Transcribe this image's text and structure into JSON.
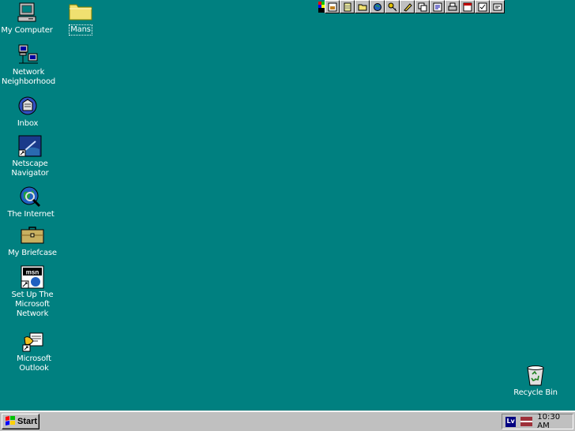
{
  "desktop": {
    "icons": [
      {
        "label": "My Computer",
        "icon": "my-computer-icon"
      },
      {
        "label": "Network\nNeighborhood",
        "icon": "network-icon"
      },
      {
        "label": "Inbox",
        "icon": "inbox-icon"
      },
      {
        "label": "Netscape\nNavigator",
        "icon": "netscape-icon"
      },
      {
        "label": "The Internet",
        "icon": "internet-icon"
      },
      {
        "label": "My Briefcase",
        "icon": "briefcase-icon"
      },
      {
        "label": "Set Up The\nMicrosoft\nNetwork",
        "icon": "msn-icon"
      },
      {
        "label": "Microsoft\nOutlook",
        "icon": "outlook-icon"
      },
      {
        "label": "Mans",
        "icon": "folder-icon"
      },
      {
        "label": "Recycle Bin",
        "icon": "recycle-bin-icon"
      }
    ],
    "background_color": "#008080"
  },
  "office_bar": {
    "buttons": [
      "office-logo-icon",
      "new-document-icon",
      "new-note-icon",
      "open-folder-icon",
      "search-icon",
      "key-icon",
      "notes-icon",
      "copy-icon",
      "word-icon",
      "print-icon",
      "calendar-icon",
      "task-icon",
      "contact-icon"
    ]
  },
  "taskbar": {
    "start_label": "Start",
    "language": "Lv",
    "clock": "10:30 AM"
  }
}
